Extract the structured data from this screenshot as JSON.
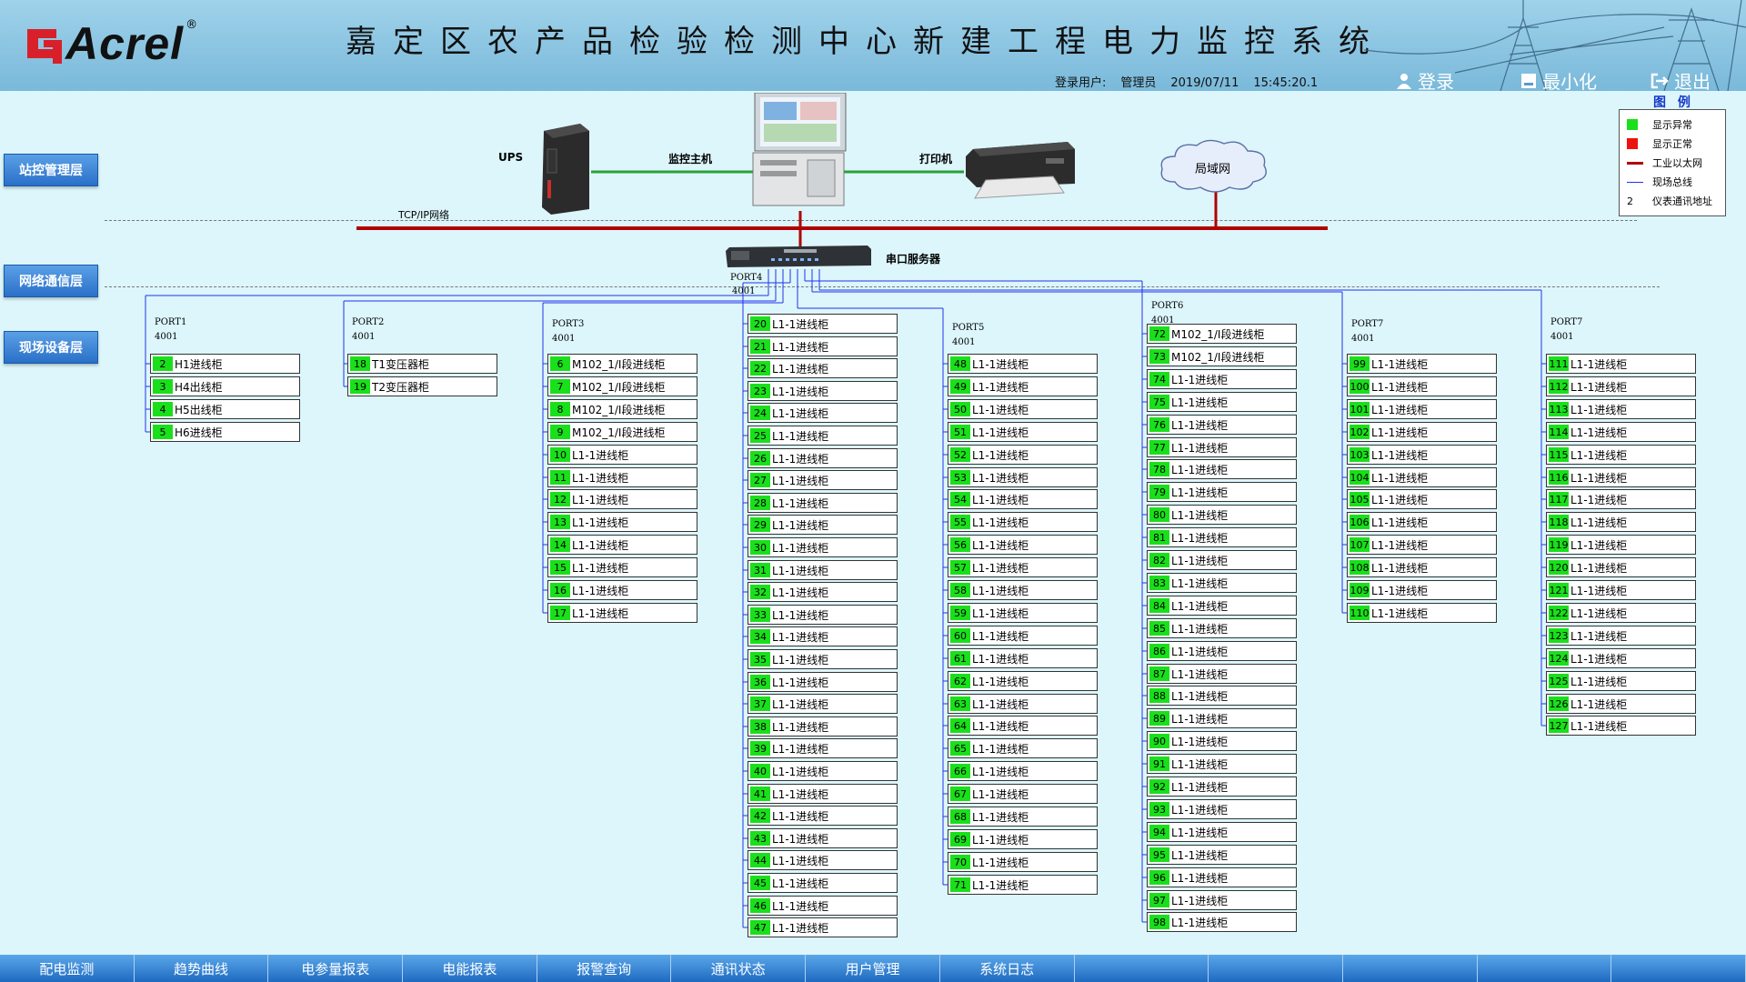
{
  "header": {
    "logo_text": "Acrel",
    "logo_reg": "®",
    "title": "嘉定区农产品检验检测中心新建工程电力监控系统",
    "user_label": "登录用户:",
    "user_name": "管理员",
    "date": "2019/07/11",
    "time": "15:45:20.1",
    "btn_login": "登录",
    "btn_minimize": "最小化",
    "btn_exit": "退出"
  },
  "layers": {
    "station": "站控管理层",
    "network": "网络通信层",
    "field": "现场设备层"
  },
  "topology": {
    "ups": "UPS",
    "host": "监控主机",
    "printer": "打印机",
    "lan": "局域网",
    "tcpip": "TCP/IP网络",
    "serial_server": "串口服务器",
    "port4_label": "PORT4",
    "port4_addr": "4001"
  },
  "legend": {
    "title": "图  例",
    "abnormal": "显示异常",
    "normal": "显示正常",
    "ethernet": "工业以太网",
    "fieldbus": "现场总线",
    "addr_sample": "2",
    "addr": "仪表通讯地址",
    "abnormal_color": "#19e01b",
    "normal_color": "#ee1111",
    "ethernet_color": "#b00000",
    "fieldbus_color": "#2233ee"
  },
  "ports": [
    {
      "label": "PORT1",
      "addr": "4001",
      "devices": [
        {
          "id": "2",
          "name": "H1进线柜"
        },
        {
          "id": "3",
          "name": "H4出线柜"
        },
        {
          "id": "4",
          "name": "H5出线柜"
        },
        {
          "id": "5",
          "name": "H6进线柜"
        }
      ]
    },
    {
      "label": "PORT2",
      "addr": "4001",
      "devices": [
        {
          "id": "18",
          "name": "T1变压器柜"
        },
        {
          "id": "19",
          "name": "T2变压器柜"
        }
      ]
    },
    {
      "label": "PORT3",
      "addr": "4001",
      "devices": [
        {
          "id": "6",
          "name": "M102_1/I段进线柜"
        },
        {
          "id": "7",
          "name": "M102_1/I段进线柜"
        },
        {
          "id": "8",
          "name": "M102_1/I段进线柜"
        },
        {
          "id": "9",
          "name": "M102_1/I段进线柜"
        },
        {
          "id": "10",
          "name": "L1-1进线柜"
        },
        {
          "id": "11",
          "name": "L1-1进线柜"
        },
        {
          "id": "12",
          "name": "L1-1进线柜"
        },
        {
          "id": "13",
          "name": "L1-1进线柜"
        },
        {
          "id": "14",
          "name": "L1-1进线柜"
        },
        {
          "id": "15",
          "name": "L1-1进线柜"
        },
        {
          "id": "16",
          "name": "L1-1进线柜"
        },
        {
          "id": "17",
          "name": "L1-1进线柜"
        }
      ]
    },
    {
      "label": "",
      "addr": "",
      "devices": [
        {
          "id": "20",
          "name": "L1-1进线柜"
        },
        {
          "id": "21",
          "name": "L1-1进线柜"
        },
        {
          "id": "22",
          "name": "L1-1进线柜"
        },
        {
          "id": "23",
          "name": "L1-1进线柜"
        },
        {
          "id": "24",
          "name": "L1-1进线柜"
        },
        {
          "id": "25",
          "name": "L1-1进线柜"
        },
        {
          "id": "26",
          "name": "L1-1进线柜"
        },
        {
          "id": "27",
          "name": "L1-1进线柜"
        },
        {
          "id": "28",
          "name": "L1-1进线柜"
        },
        {
          "id": "29",
          "name": "L1-1进线柜"
        },
        {
          "id": "30",
          "name": "L1-1进线柜"
        },
        {
          "id": "31",
          "name": "L1-1进线柜"
        },
        {
          "id": "32",
          "name": "L1-1进线柜"
        },
        {
          "id": "33",
          "name": "L1-1进线柜"
        },
        {
          "id": "34",
          "name": "L1-1进线柜"
        },
        {
          "id": "35",
          "name": "L1-1进线柜"
        },
        {
          "id": "36",
          "name": "L1-1进线柜"
        },
        {
          "id": "37",
          "name": "L1-1进线柜"
        },
        {
          "id": "38",
          "name": "L1-1进线柜"
        },
        {
          "id": "39",
          "name": "L1-1进线柜"
        },
        {
          "id": "40",
          "name": "L1-1进线柜"
        },
        {
          "id": "41",
          "name": "L1-1进线柜"
        },
        {
          "id": "42",
          "name": "L1-1进线柜"
        },
        {
          "id": "43",
          "name": "L1-1进线柜"
        },
        {
          "id": "44",
          "name": "L1-1进线柜"
        },
        {
          "id": "45",
          "name": "L1-1进线柜"
        },
        {
          "id": "46",
          "name": "L1-1进线柜"
        },
        {
          "id": "47",
          "name": "L1-1进线柜"
        }
      ]
    },
    {
      "label": "PORT5",
      "addr": "4001",
      "devices": [
        {
          "id": "48",
          "name": "L1-1进线柜"
        },
        {
          "id": "49",
          "name": "L1-1进线柜"
        },
        {
          "id": "50",
          "name": "L1-1进线柜"
        },
        {
          "id": "51",
          "name": "L1-1进线柜"
        },
        {
          "id": "52",
          "name": "L1-1进线柜"
        },
        {
          "id": "53",
          "name": "L1-1进线柜"
        },
        {
          "id": "54",
          "name": "L1-1进线柜"
        },
        {
          "id": "55",
          "name": "L1-1进线柜"
        },
        {
          "id": "56",
          "name": "L1-1进线柜"
        },
        {
          "id": "57",
          "name": "L1-1进线柜"
        },
        {
          "id": "58",
          "name": "L1-1进线柜"
        },
        {
          "id": "59",
          "name": "L1-1进线柜"
        },
        {
          "id": "60",
          "name": "L1-1进线柜"
        },
        {
          "id": "61",
          "name": "L1-1进线柜"
        },
        {
          "id": "62",
          "name": "L1-1进线柜"
        },
        {
          "id": "63",
          "name": "L1-1进线柜"
        },
        {
          "id": "64",
          "name": "L1-1进线柜"
        },
        {
          "id": "65",
          "name": "L1-1进线柜"
        },
        {
          "id": "66",
          "name": "L1-1进线柜"
        },
        {
          "id": "67",
          "name": "L1-1进线柜"
        },
        {
          "id": "68",
          "name": "L1-1进线柜"
        },
        {
          "id": "69",
          "name": "L1-1进线柜"
        },
        {
          "id": "70",
          "name": "L1-1进线柜"
        },
        {
          "id": "71",
          "name": "L1-1进线柜"
        }
      ]
    },
    {
      "label": "PORT6",
      "addr": "4001",
      "devices": [
        {
          "id": "72",
          "name": "M102_1/I段进线柜"
        },
        {
          "id": "73",
          "name": "M102_1/I段进线柜"
        },
        {
          "id": "74",
          "name": "L1-1进线柜"
        },
        {
          "id": "75",
          "name": "L1-1进线柜"
        },
        {
          "id": "76",
          "name": "L1-1进线柜"
        },
        {
          "id": "77",
          "name": "L1-1进线柜"
        },
        {
          "id": "78",
          "name": "L1-1进线柜"
        },
        {
          "id": "79",
          "name": "L1-1进线柜"
        },
        {
          "id": "80",
          "name": "L1-1进线柜"
        },
        {
          "id": "81",
          "name": "L1-1进线柜"
        },
        {
          "id": "82",
          "name": "L1-1进线柜"
        },
        {
          "id": "83",
          "name": "L1-1进线柜"
        },
        {
          "id": "84",
          "name": "L1-1进线柜"
        },
        {
          "id": "85",
          "name": "L1-1进线柜"
        },
        {
          "id": "86",
          "name": "L1-1进线柜"
        },
        {
          "id": "87",
          "name": "L1-1进线柜"
        },
        {
          "id": "88",
          "name": "L1-1进线柜"
        },
        {
          "id": "89",
          "name": "L1-1进线柜"
        },
        {
          "id": "90",
          "name": "L1-1进线柜"
        },
        {
          "id": "91",
          "name": "L1-1进线柜"
        },
        {
          "id": "92",
          "name": "L1-1进线柜"
        },
        {
          "id": "93",
          "name": "L1-1进线柜"
        },
        {
          "id": "94",
          "name": "L1-1进线柜"
        },
        {
          "id": "95",
          "name": "L1-1进线柜"
        },
        {
          "id": "96",
          "name": "L1-1进线柜"
        },
        {
          "id": "97",
          "name": "L1-1进线柜"
        },
        {
          "id": "98",
          "name": "L1-1进线柜"
        }
      ]
    },
    {
      "label": "PORT7",
      "addr": "4001",
      "devices": [
        {
          "id": "99",
          "name": "L1-1进线柜"
        },
        {
          "id": "100",
          "name": "L1-1进线柜"
        },
        {
          "id": "101",
          "name": "L1-1进线柜"
        },
        {
          "id": "102",
          "name": "L1-1进线柜"
        },
        {
          "id": "103",
          "name": "L1-1进线柜"
        },
        {
          "id": "104",
          "name": "L1-1进线柜"
        },
        {
          "id": "105",
          "name": "L1-1进线柜"
        },
        {
          "id": "106",
          "name": "L1-1进线柜"
        },
        {
          "id": "107",
          "name": "L1-1进线柜"
        },
        {
          "id": "108",
          "name": "L1-1进线柜"
        },
        {
          "id": "109",
          "name": "L1-1进线柜"
        },
        {
          "id": "110",
          "name": "L1-1进线柜"
        }
      ]
    },
    {
      "label": "PORT7",
      "addr": "4001",
      "devices": [
        {
          "id": "111",
          "name": "L1-1进线柜"
        },
        {
          "id": "112",
          "name": "L1-1进线柜"
        },
        {
          "id": "113",
          "name": "L1-1进线柜"
        },
        {
          "id": "114",
          "name": "L1-1进线柜"
        },
        {
          "id": "115",
          "name": "L1-1进线柜"
        },
        {
          "id": "116",
          "name": "L1-1进线柜"
        },
        {
          "id": "117",
          "name": "L1-1进线柜"
        },
        {
          "id": "118",
          "name": "L1-1进线柜"
        },
        {
          "id": "119",
          "name": "L1-1进线柜"
        },
        {
          "id": "120",
          "name": "L1-1进线柜"
        },
        {
          "id": "121",
          "name": "L1-1进线柜"
        },
        {
          "id": "122",
          "name": "L1-1进线柜"
        },
        {
          "id": "123",
          "name": "L1-1进线柜"
        },
        {
          "id": "124",
          "name": "L1-1进线柜"
        },
        {
          "id": "125",
          "name": "L1-1进线柜"
        },
        {
          "id": "126",
          "name": "L1-1进线柜"
        },
        {
          "id": "127",
          "name": "L1-1进线柜"
        }
      ]
    }
  ],
  "tabs": [
    "配电监测",
    "趋势曲线",
    "电参量报表",
    "电能报表",
    "报警查询",
    "通讯状态",
    "用户管理",
    "系统日志",
    "",
    "",
    "",
    "",
    ""
  ]
}
